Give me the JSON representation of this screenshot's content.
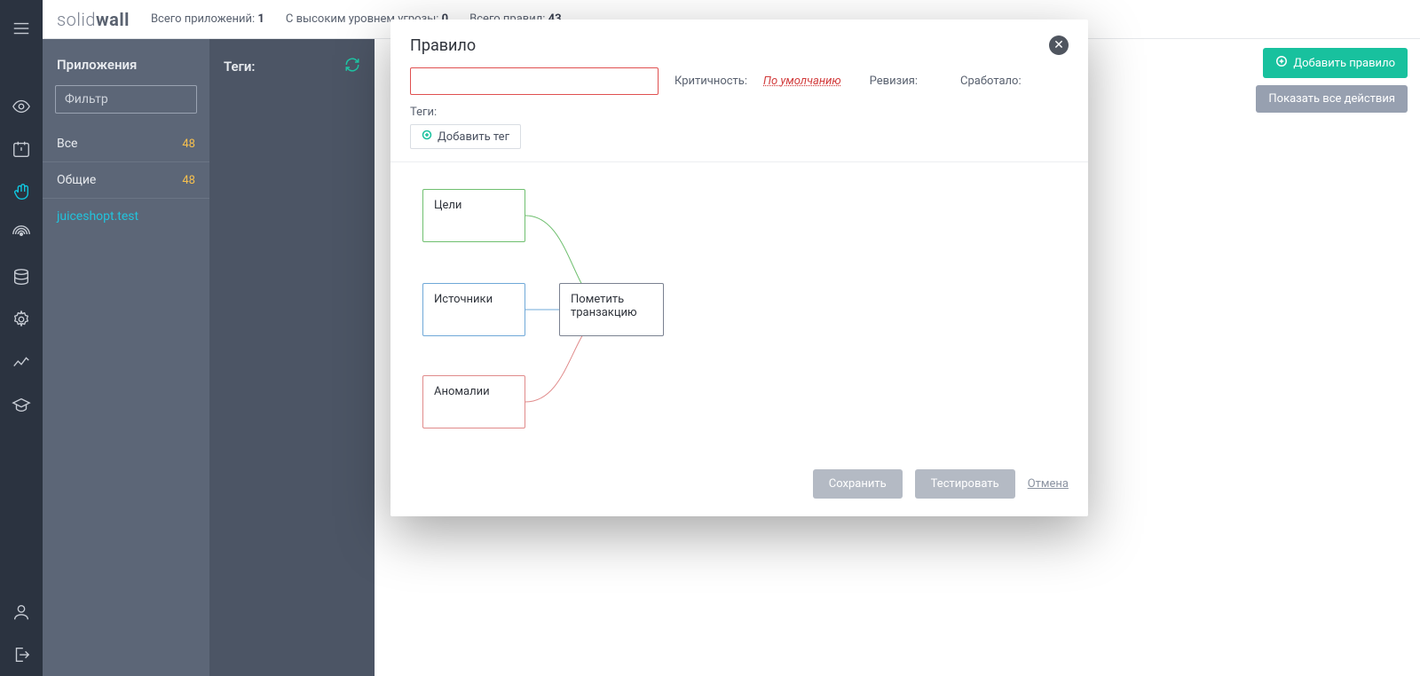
{
  "header": {
    "brand_a": "solid",
    "brand_b": "wall",
    "stat1_label": "Всего приложений: ",
    "stat1_value": "1",
    "stat2_label": "С высоким уровнем угрозы: ",
    "stat2_value": "0",
    "stat3_label": "Всего правил: ",
    "stat3_value": "43"
  },
  "panel": {
    "title": "Приложения",
    "filter_placeholder": "Фильтр",
    "rows": [
      {
        "label": "Все",
        "count": "48"
      },
      {
        "label": "Общие",
        "count": "48"
      }
    ],
    "link": "juiceshopt.test"
  },
  "tagscol": {
    "title": "Теги:"
  },
  "actions": {
    "add_rule": "Добавить правило",
    "show_all": "Показать все действия"
  },
  "modal": {
    "title": "Правило",
    "crit_label": "Критичность:",
    "crit_value": "По умолчанию",
    "rev_label": "Ревизия:",
    "trig_label": "Сработало:",
    "tags_label": "Теги:",
    "add_tag": "Добавить тег",
    "nodes": {
      "targets": "Цели",
      "sources": "Источники",
      "anomalies": "Аномалии",
      "action": "Пометить транзакцию"
    },
    "save": "Сохранить",
    "test": "Тестировать",
    "cancel": "Отмена"
  }
}
